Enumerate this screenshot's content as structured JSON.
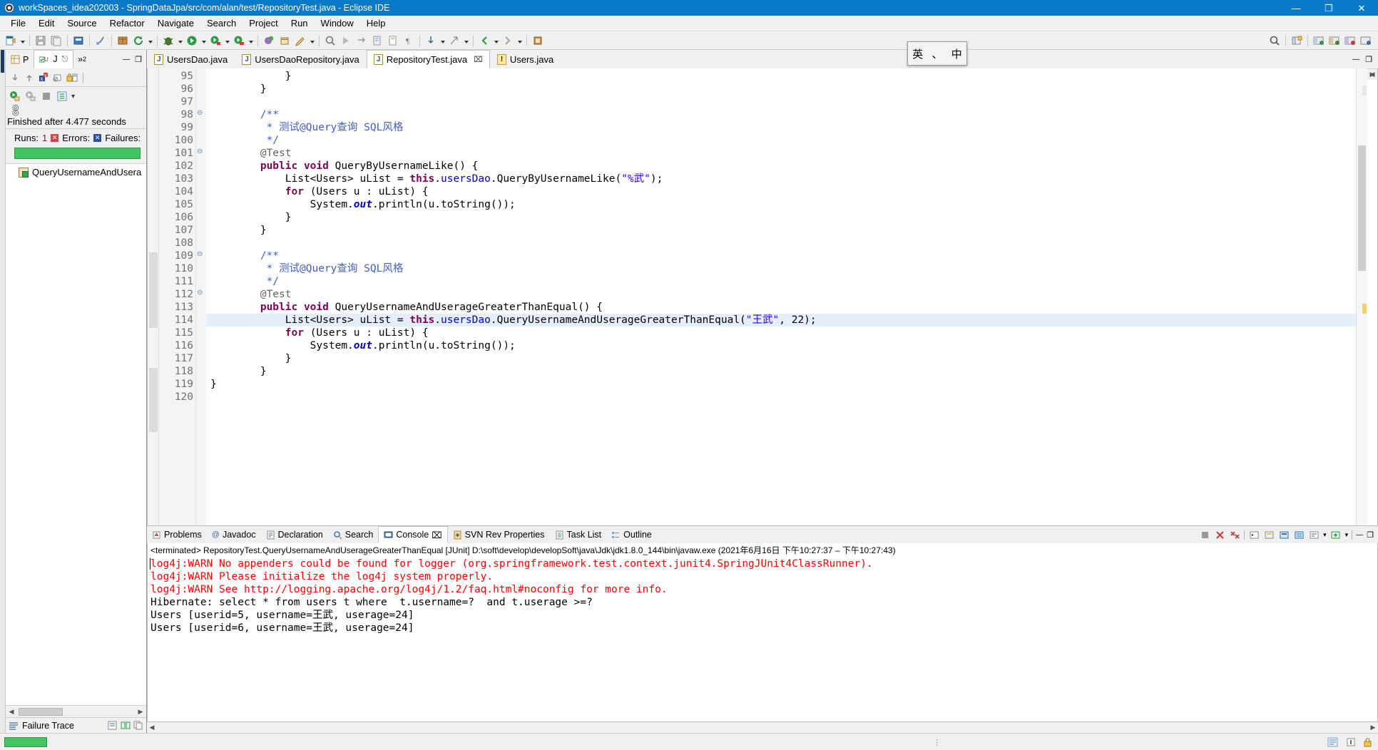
{
  "window": {
    "title": "workSpaces_idea202003 - SpringDataJpa/src/com/alan/test/RepositoryTest.java - Eclipse IDE",
    "app_icon": "eclipse-icon",
    "minimize": "—",
    "maximize": "❐",
    "close": "✕"
  },
  "menubar": {
    "items": [
      {
        "label": "File"
      },
      {
        "label": "Edit"
      },
      {
        "label": "Source"
      },
      {
        "label": "Refactor"
      },
      {
        "label": "Navigate"
      },
      {
        "label": "Search"
      },
      {
        "label": "Project"
      },
      {
        "label": "Run"
      },
      {
        "label": "Window"
      },
      {
        "label": "Help"
      }
    ]
  },
  "ime": {
    "left": "英",
    "mid": "、",
    "right": "中"
  },
  "junit": {
    "tabs": [
      {
        "label": "P",
        "icon": "package-explorer-icon",
        "active": false
      },
      {
        "label": "J",
        "icon": "junit-icon",
        "active": true
      }
    ],
    "more_tabs": "»",
    "more_count": "2",
    "minimize": "—",
    "maximize": "❐",
    "nav_icons": [
      "arrow-down-icon",
      "arrow-up-icon",
      "next-failure-icon",
      "filter-icon",
      "lock-icon"
    ],
    "run_icons": [
      "rerun-icon",
      "rerun-failed-icon",
      "stop-icon",
      "history-icon"
    ],
    "history_arrow": "▾",
    "status": "Finished after 4.477 seconds",
    "counters": {
      "runs_label": "Runs:",
      "runs_value": "1",
      "errors_label": "Errors:",
      "failures_label": "Failures:"
    },
    "progress_color": "#43c463",
    "tree": [
      {
        "label": "QueryUsernameAndUsera",
        "icon": "test-case-icon"
      }
    ],
    "failure_trace": "Failure Trace",
    "ft_icons": [
      "filter-stack-icon",
      "compare-icon",
      "copy-icon"
    ]
  },
  "editor": {
    "tabs": [
      {
        "label": "UsersDao.java",
        "icon": "java-file-icon",
        "active": false,
        "closable": false
      },
      {
        "label": "UsersDaoRepository.java",
        "icon": "java-file-icon",
        "active": false,
        "closable": false
      },
      {
        "label": "RepositoryTest.java",
        "icon": "java-file-icon",
        "active": true,
        "closable": true,
        "close": "⌧"
      },
      {
        "label": "Users.java",
        "icon": "java-warning-file-icon",
        "active": false,
        "closable": false
      }
    ],
    "minimize": "—",
    "maximize": "❐",
    "first_line_number": 95,
    "lines": [
      {
        "n": 95,
        "fold": null,
        "hl": false,
        "tokens": [
          {
            "t": "            }",
            "c": ""
          }
        ]
      },
      {
        "n": 96,
        "fold": null,
        "hl": false,
        "tokens": [
          {
            "t": "        }",
            "c": ""
          }
        ]
      },
      {
        "n": 97,
        "fold": null,
        "hl": false,
        "tokens": [
          {
            "t": "",
            "c": ""
          }
        ]
      },
      {
        "n": 98,
        "fold": "⊖",
        "hl": false,
        "tokens": [
          {
            "t": "        /**",
            "c": "cm"
          }
        ]
      },
      {
        "n": 99,
        "fold": null,
        "hl": false,
        "tokens": [
          {
            "t": "         * 测试@Query查询 SQL风格",
            "c": "cm"
          }
        ]
      },
      {
        "n": 100,
        "fold": null,
        "hl": false,
        "tokens": [
          {
            "t": "         */",
            "c": "cm"
          }
        ]
      },
      {
        "n": 101,
        "fold": "⊖",
        "hl": false,
        "tokens": [
          {
            "t": "        @Test",
            "c": "ann"
          }
        ]
      },
      {
        "n": 102,
        "fold": null,
        "hl": false,
        "tokens": [
          {
            "t": "        ",
            "c": ""
          },
          {
            "t": "public void",
            "c": "kw"
          },
          {
            "t": " QueryByUsernameLike() {",
            "c": ""
          }
        ]
      },
      {
        "n": 103,
        "fold": null,
        "hl": false,
        "tokens": [
          {
            "t": "            List<Users> uList = ",
            "c": ""
          },
          {
            "t": "this",
            "c": "kw"
          },
          {
            "t": ".",
            "c": ""
          },
          {
            "t": "usersDao",
            "c": "fld"
          },
          {
            "t": ".QueryByUsernameLike(",
            "c": ""
          },
          {
            "t": "\"%武\"",
            "c": "str"
          },
          {
            "t": ");",
            "c": ""
          }
        ]
      },
      {
        "n": 104,
        "fold": null,
        "hl": false,
        "tokens": [
          {
            "t": "            ",
            "c": ""
          },
          {
            "t": "for",
            "c": "kw"
          },
          {
            "t": " (Users u : uList) {",
            "c": ""
          }
        ]
      },
      {
        "n": 105,
        "fold": null,
        "hl": false,
        "tokens": [
          {
            "t": "                System.",
            "c": ""
          },
          {
            "t": "out",
            "c": "stat"
          },
          {
            "t": ".println(u.toString());",
            "c": ""
          }
        ]
      },
      {
        "n": 106,
        "fold": null,
        "hl": false,
        "tokens": [
          {
            "t": "            }",
            "c": ""
          }
        ]
      },
      {
        "n": 107,
        "fold": null,
        "hl": false,
        "tokens": [
          {
            "t": "        }",
            "c": ""
          }
        ]
      },
      {
        "n": 108,
        "fold": null,
        "hl": false,
        "tokens": [
          {
            "t": "",
            "c": ""
          }
        ]
      },
      {
        "n": 109,
        "fold": "⊖",
        "hl": false,
        "tokens": [
          {
            "t": "        /**",
            "c": "cm"
          }
        ]
      },
      {
        "n": 110,
        "fold": null,
        "hl": false,
        "tokens": [
          {
            "t": "         * 测试@Query查询 SQL风格",
            "c": "cm"
          }
        ]
      },
      {
        "n": 111,
        "fold": null,
        "hl": false,
        "tokens": [
          {
            "t": "         */",
            "c": "cm"
          }
        ]
      },
      {
        "n": 112,
        "fold": "⊖",
        "hl": false,
        "tokens": [
          {
            "t": "        @Test",
            "c": "ann"
          }
        ]
      },
      {
        "n": 113,
        "fold": null,
        "hl": false,
        "tokens": [
          {
            "t": "        ",
            "c": ""
          },
          {
            "t": "public void",
            "c": "kw"
          },
          {
            "t": " QueryUsernameAndUserageGreaterThanEqual() {",
            "c": ""
          }
        ]
      },
      {
        "n": 114,
        "fold": null,
        "hl": true,
        "tokens": [
          {
            "t": "            List<Users> uList = ",
            "c": ""
          },
          {
            "t": "this",
            "c": "kw"
          },
          {
            "t": ".",
            "c": ""
          },
          {
            "t": "usersDao",
            "c": "fld"
          },
          {
            "t": ".QueryUsernameAndUserageGreaterThanEqual(",
            "c": ""
          },
          {
            "t": "\"王武\"",
            "c": "str"
          },
          {
            "t": ", 22);",
            "c": ""
          }
        ]
      },
      {
        "n": 115,
        "fold": null,
        "hl": false,
        "tokens": [
          {
            "t": "            ",
            "c": ""
          },
          {
            "t": "for",
            "c": "kw"
          },
          {
            "t": " (Users u : uList) {",
            "c": ""
          }
        ]
      },
      {
        "n": 116,
        "fold": null,
        "hl": false,
        "tokens": [
          {
            "t": "                System.",
            "c": ""
          },
          {
            "t": "out",
            "c": "stat"
          },
          {
            "t": ".println(u.toString());",
            "c": ""
          }
        ]
      },
      {
        "n": 117,
        "fold": null,
        "hl": false,
        "tokens": [
          {
            "t": "            }",
            "c": ""
          }
        ]
      },
      {
        "n": 118,
        "fold": null,
        "hl": false,
        "tokens": [
          {
            "t": "        }",
            "c": ""
          }
        ]
      },
      {
        "n": 119,
        "fold": null,
        "hl": false,
        "tokens": [
          {
            "t": "}",
            "c": ""
          }
        ]
      },
      {
        "n": 120,
        "fold": null,
        "hl": false,
        "tokens": [
          {
            "t": "",
            "c": ""
          }
        ]
      }
    ]
  },
  "console": {
    "tabs": [
      {
        "label": "Problems",
        "icon": "problems-icon",
        "active": false
      },
      {
        "label": "Javadoc",
        "icon": "javadoc-icon",
        "active": false
      },
      {
        "label": "Declaration",
        "icon": "declaration-icon",
        "active": false
      },
      {
        "label": "Search",
        "icon": "search-icon",
        "active": false
      },
      {
        "label": "Console",
        "icon": "console-icon",
        "active": true,
        "close": "⌧"
      },
      {
        "label": "SVN Rev Properties",
        "icon": "svn-icon",
        "active": false
      },
      {
        "label": "Task List",
        "icon": "task-list-icon",
        "active": false
      },
      {
        "label": "Outline",
        "icon": "outline-icon",
        "active": false
      }
    ],
    "tool_icons": [
      "terminate-all-icon",
      "remove-launch-icon",
      "remove-all-icon",
      "open-console-icon",
      "pin-console-icon",
      "display-selected-icon",
      "scroll-lock-icon",
      "word-wrap-icon",
      "new-console-icon"
    ],
    "tool_arrows": [
      "▾",
      "▾"
    ],
    "minimize": "—",
    "maximize": "❐",
    "status_line": "<terminated> RepositoryTest.QueryUsernameAndUserageGreaterThanEqual [JUnit] D:\\soft\\develop\\developSoft\\java\\Jdk\\jdk1.8.0_144\\bin\\javaw.exe  (2021年6月16日 下午10:27:37 – 下午10:27:43)",
    "output": [
      {
        "text": "log4j:WARN No appenders could be found for logger (org.springframework.test.context.junit4.SpringJUnit4ClassRunner).",
        "warn": true
      },
      {
        "text": "log4j:WARN Please initialize the log4j system properly.",
        "warn": true
      },
      {
        "text": "log4j:WARN See http://logging.apache.org/log4j/1.2/faq.html#noconfig for more info.",
        "warn": true
      },
      {
        "text": "Hibernate: select * from users t where  t.username=?  and t.userage >=?",
        "warn": false
      },
      {
        "text": "Users [userid=5, username=王武, userage=24]",
        "warn": false
      },
      {
        "text": "Users [userid=6, username=王武, userage=24]",
        "warn": false
      }
    ]
  },
  "statusbar": {
    "dots": "⋮",
    "right_icons": [
      "writable-icon",
      "smart-insert-icon",
      "lock-icon"
    ],
    "progress_color": "#43c463"
  }
}
